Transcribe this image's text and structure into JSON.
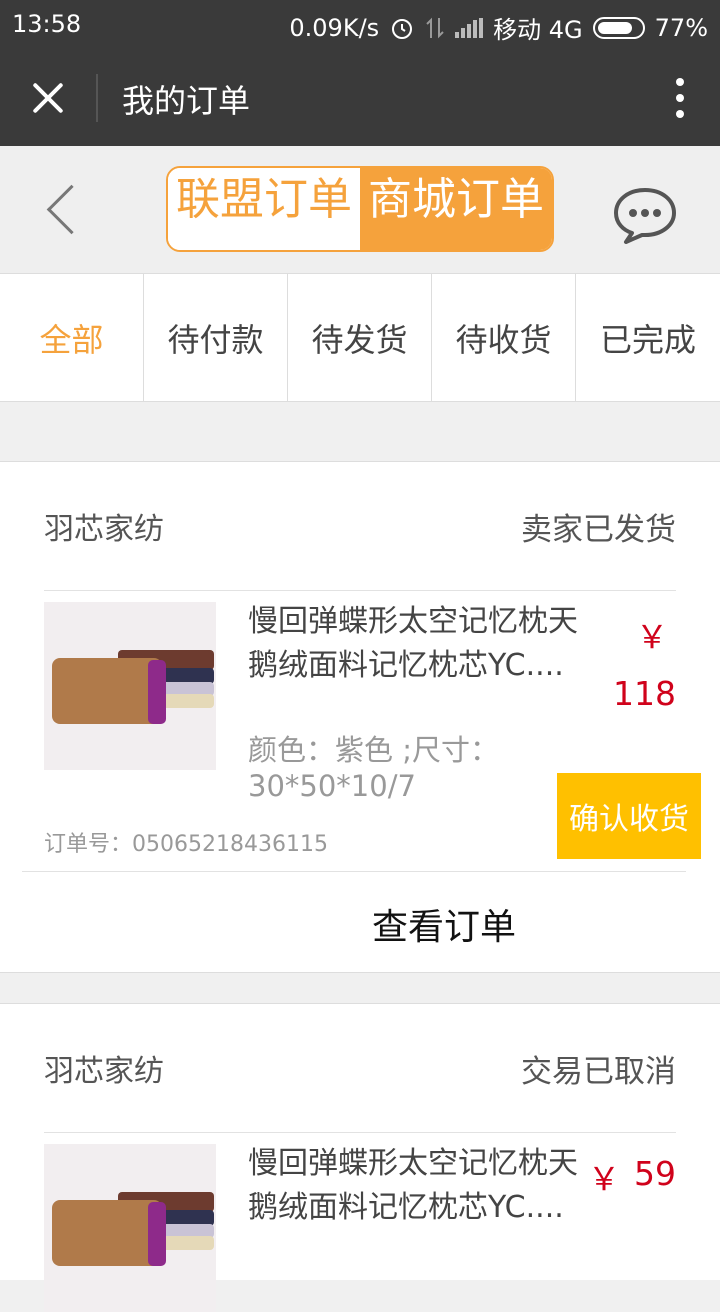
{
  "status_bar": {
    "time": "13:58",
    "net_speed": "0.09K/s",
    "carrier": "移动 4G",
    "battery": "77%"
  },
  "title_bar": {
    "title": "我的订单",
    "close_icon": "close-icon",
    "more_icon": "more-vert-icon"
  },
  "segment": {
    "items": [
      "联盟订单",
      "商城订单"
    ],
    "active_index": 1,
    "back_icon": "chevron-left-icon",
    "chat_icon": "chat-bubble-icon"
  },
  "filters": {
    "tabs": [
      "全部",
      "待付款",
      "待发货",
      "待收货",
      "已完成"
    ],
    "active_index": 0
  },
  "colors": {
    "accent": "#f5a23c",
    "price": "#d0021b",
    "confirm_button": "#ffc000",
    "title_bar": "#3a3a3a"
  },
  "orders": [
    {
      "shop": "羽芯家纺",
      "status": "卖家已发货",
      "product_name": "慢回弹蝶形太空记忆枕天鹅绒面料记忆枕芯YC....",
      "spec": "颜色：紫色 ;尺寸：30*50*10/7",
      "currency": "￥",
      "price": "118",
      "order_no": "订单号：05065218436115",
      "action": "确认收货",
      "view_label": "查看订单"
    },
    {
      "shop": "羽芯家纺",
      "status": "交易已取消",
      "product_name": "慢回弹蝶形太空记忆枕天鹅绒面料记忆枕芯YC....",
      "currency": "￥",
      "price": "59"
    }
  ]
}
